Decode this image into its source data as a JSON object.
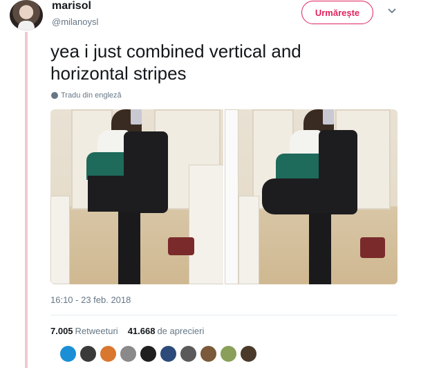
{
  "author": {
    "name": "marisol",
    "handle": "@milanoysl"
  },
  "follow_button": {
    "label": "Urmărește"
  },
  "tweet": {
    "text": "yea i just combined vertical and horizontal stripes",
    "translate_label": "Tradu din engleză",
    "timestamp": "16:10 - 23 feb. 2018"
  },
  "stats": {
    "retweets_count": "7.005",
    "retweets_label": "Retweeturi",
    "likes_count": "41.668",
    "likes_label": "de aprecieri"
  },
  "likers": [
    "#1a8fd6",
    "#3a3a3a",
    "#d9772f",
    "#8a8a8a",
    "#1f1f1f",
    "#2c4b7a",
    "#5a5a5a",
    "#7a5a3a",
    "#8aa05a",
    "#4a3a2a"
  ],
  "icons": [
    "chevron-down-icon",
    "globe-icon"
  ],
  "colors": {
    "accent": "#e0245e",
    "thread_line": "#f2c8d0",
    "secondary_text": "#657786"
  }
}
